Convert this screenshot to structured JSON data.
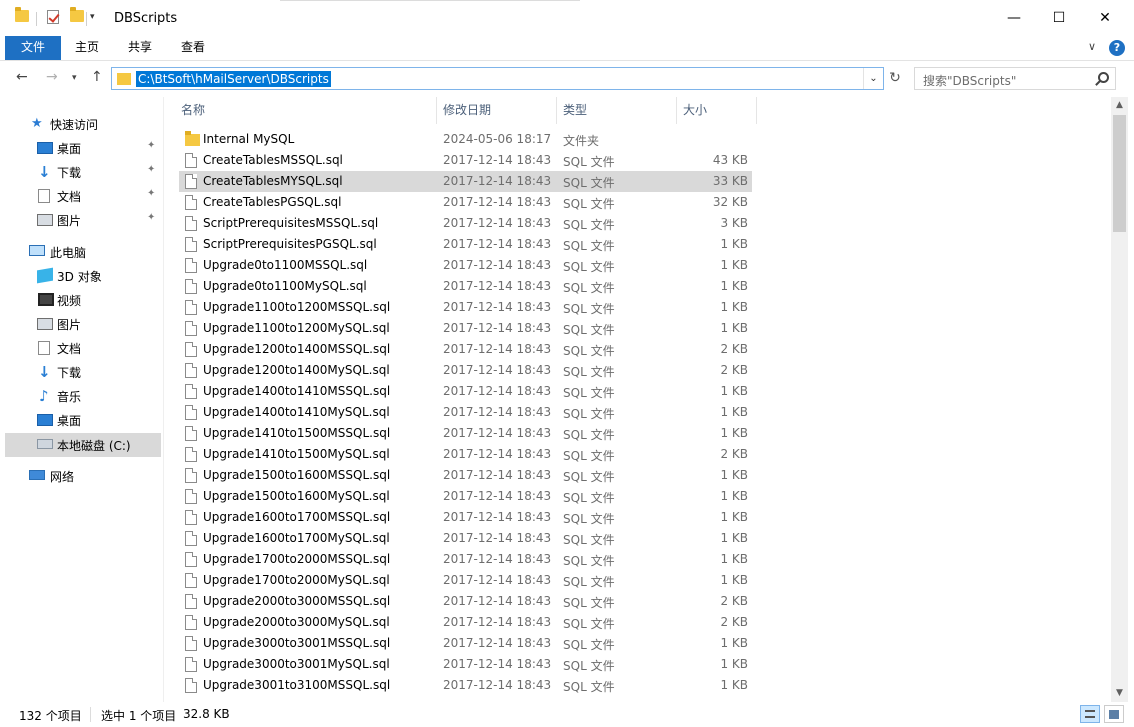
{
  "window": {
    "title": "DBScripts",
    "minimize": "—",
    "maximize": "☐",
    "close": "✕"
  },
  "ribbon": {
    "tabs": [
      {
        "label": "文件"
      },
      {
        "label": "主页"
      },
      {
        "label": "共享"
      },
      {
        "label": "查看"
      }
    ],
    "collapse_glyph": "∨",
    "help_glyph": "?"
  },
  "address": {
    "path": "C:\\BtSoft\\hMailServer\\DBScripts",
    "search_placeholder": "搜索\"DBScripts\""
  },
  "nav": {
    "quick_access": "快速访问",
    "quick_items": [
      {
        "label": "桌面"
      },
      {
        "label": "下载"
      },
      {
        "label": "文档"
      },
      {
        "label": "图片"
      }
    ],
    "this_pc": "此电脑",
    "pc_items": [
      {
        "label": "3D 对象"
      },
      {
        "label": "视频"
      },
      {
        "label": "图片"
      },
      {
        "label": "文档"
      },
      {
        "label": "下载"
      },
      {
        "label": "音乐"
      },
      {
        "label": "桌面"
      },
      {
        "label": "本地磁盘 (C:)"
      }
    ],
    "network": "网络"
  },
  "columns": {
    "name": "名称",
    "date": "修改日期",
    "type": "类型",
    "size": "大小"
  },
  "files": [
    {
      "name": "Internal MySQL",
      "date": "2024-05-06 18:17",
      "type": "文件夹",
      "size": "",
      "kind": "folder"
    },
    {
      "name": "CreateTablesMSSQL.sql",
      "date": "2017-12-14 18:43",
      "type": "SQL 文件",
      "size": "43 KB",
      "kind": "file"
    },
    {
      "name": "CreateTablesMYSQL.sql",
      "date": "2017-12-14 18:43",
      "type": "SQL 文件",
      "size": "33 KB",
      "kind": "file"
    },
    {
      "name": "CreateTablesPGSQL.sql",
      "date": "2017-12-14 18:43",
      "type": "SQL 文件",
      "size": "32 KB",
      "kind": "file"
    },
    {
      "name": "ScriptPrerequisitesMSSQL.sql",
      "date": "2017-12-14 18:43",
      "type": "SQL 文件",
      "size": "3 KB",
      "kind": "file"
    },
    {
      "name": "ScriptPrerequisitesPGSQL.sql",
      "date": "2017-12-14 18:43",
      "type": "SQL 文件",
      "size": "1 KB",
      "kind": "file"
    },
    {
      "name": "Upgrade0to1100MSSQL.sql",
      "date": "2017-12-14 18:43",
      "type": "SQL 文件",
      "size": "1 KB",
      "kind": "file"
    },
    {
      "name": "Upgrade0to1100MySQL.sql",
      "date": "2017-12-14 18:43",
      "type": "SQL 文件",
      "size": "1 KB",
      "kind": "file"
    },
    {
      "name": "Upgrade1100to1200MSSQL.sql",
      "date": "2017-12-14 18:43",
      "type": "SQL 文件",
      "size": "1 KB",
      "kind": "file"
    },
    {
      "name": "Upgrade1100to1200MySQL.sql",
      "date": "2017-12-14 18:43",
      "type": "SQL 文件",
      "size": "1 KB",
      "kind": "file"
    },
    {
      "name": "Upgrade1200to1400MSSQL.sql",
      "date": "2017-12-14 18:43",
      "type": "SQL 文件",
      "size": "2 KB",
      "kind": "file"
    },
    {
      "name": "Upgrade1200to1400MySQL.sql",
      "date": "2017-12-14 18:43",
      "type": "SQL 文件",
      "size": "2 KB",
      "kind": "file"
    },
    {
      "name": "Upgrade1400to1410MSSQL.sql",
      "date": "2017-12-14 18:43",
      "type": "SQL 文件",
      "size": "1 KB",
      "kind": "file"
    },
    {
      "name": "Upgrade1400to1410MySQL.sql",
      "date": "2017-12-14 18:43",
      "type": "SQL 文件",
      "size": "1 KB",
      "kind": "file"
    },
    {
      "name": "Upgrade1410to1500MSSQL.sql",
      "date": "2017-12-14 18:43",
      "type": "SQL 文件",
      "size": "1 KB",
      "kind": "file"
    },
    {
      "name": "Upgrade1410to1500MySQL.sql",
      "date": "2017-12-14 18:43",
      "type": "SQL 文件",
      "size": "2 KB",
      "kind": "file"
    },
    {
      "name": "Upgrade1500to1600MSSQL.sql",
      "date": "2017-12-14 18:43",
      "type": "SQL 文件",
      "size": "1 KB",
      "kind": "file"
    },
    {
      "name": "Upgrade1500to1600MySQL.sql",
      "date": "2017-12-14 18:43",
      "type": "SQL 文件",
      "size": "1 KB",
      "kind": "file"
    },
    {
      "name": "Upgrade1600to1700MSSQL.sql",
      "date": "2017-12-14 18:43",
      "type": "SQL 文件",
      "size": "1 KB",
      "kind": "file"
    },
    {
      "name": "Upgrade1600to1700MySQL.sql",
      "date": "2017-12-14 18:43",
      "type": "SQL 文件",
      "size": "1 KB",
      "kind": "file"
    },
    {
      "name": "Upgrade1700to2000MSSQL.sql",
      "date": "2017-12-14 18:43",
      "type": "SQL 文件",
      "size": "1 KB",
      "kind": "file"
    },
    {
      "name": "Upgrade1700to2000MySQL.sql",
      "date": "2017-12-14 18:43",
      "type": "SQL 文件",
      "size": "1 KB",
      "kind": "file"
    },
    {
      "name": "Upgrade2000to3000MSSQL.sql",
      "date": "2017-12-14 18:43",
      "type": "SQL 文件",
      "size": "2 KB",
      "kind": "file"
    },
    {
      "name": "Upgrade2000to3000MySQL.sql",
      "date": "2017-12-14 18:43",
      "type": "SQL 文件",
      "size": "2 KB",
      "kind": "file"
    },
    {
      "name": "Upgrade3000to3001MSSQL.sql",
      "date": "2017-12-14 18:43",
      "type": "SQL 文件",
      "size": "1 KB",
      "kind": "file"
    },
    {
      "name": "Upgrade3000to3001MySQL.sql",
      "date": "2017-12-14 18:43",
      "type": "SQL 文件",
      "size": "1 KB",
      "kind": "file"
    },
    {
      "name": "Upgrade3001to3100MSSQL.sql",
      "date": "2017-12-14 18:43",
      "type": "SQL 文件",
      "size": "1 KB",
      "kind": "file"
    }
  ],
  "selected_file": "CreateTablesMYSQL.sql",
  "status": {
    "count": "132 个项目",
    "selection": "选中 1 个项目",
    "size": "32.8 KB"
  },
  "colors": {
    "accent": "#1e70c3",
    "selection": "#d9d9d9",
    "highlight": "#0078d7"
  }
}
